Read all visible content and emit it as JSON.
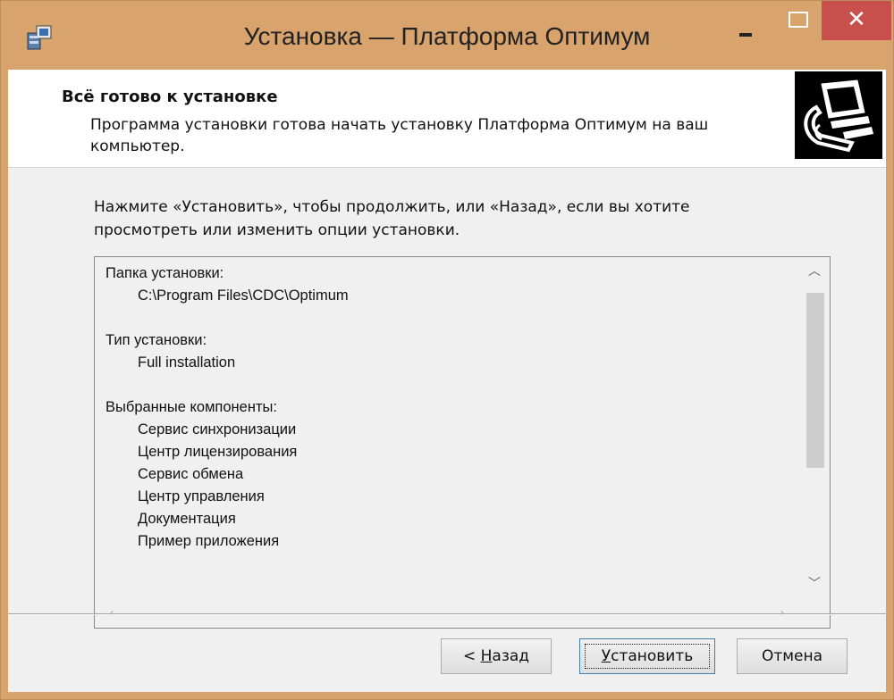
{
  "window": {
    "title": "Установка — Платформа Оптимум",
    "minimize_glyph": "",
    "close_glyph": "✕"
  },
  "header": {
    "title": "Всё готово к установке",
    "subtitle": "Программа установки готова начать установку Платформа Оптимум на ваш компьютер."
  },
  "instructions": "Нажмите «Установить», чтобы продолжить, или «Назад», если вы хотите просмотреть или изменить опции установки.",
  "memo": {
    "sections": [
      {
        "heading": "Папка установки:",
        "items": [
          "C:\\Program Files\\CDC\\Optimum"
        ]
      },
      {
        "heading": "Тип установки:",
        "items": [
          "Full installation"
        ]
      },
      {
        "heading": "Выбранные компоненты:",
        "items": [
          "Сервис синхронизации",
          "Центр лицензирования",
          "Сервис обмена",
          "Центр управления",
          "Документация",
          "Пример приложения"
        ]
      }
    ]
  },
  "buttons": {
    "back_prefix": "< ",
    "back_accel": "Н",
    "back_rest": "азад",
    "install_accel": "У",
    "install_rest": "становить",
    "cancel": "Отмена"
  },
  "icons": {
    "setup": "setup-app-icon",
    "computer": "computer-install-icon"
  },
  "colors": {
    "titlebar": "#d9a36d",
    "close": "#c74f4c"
  }
}
